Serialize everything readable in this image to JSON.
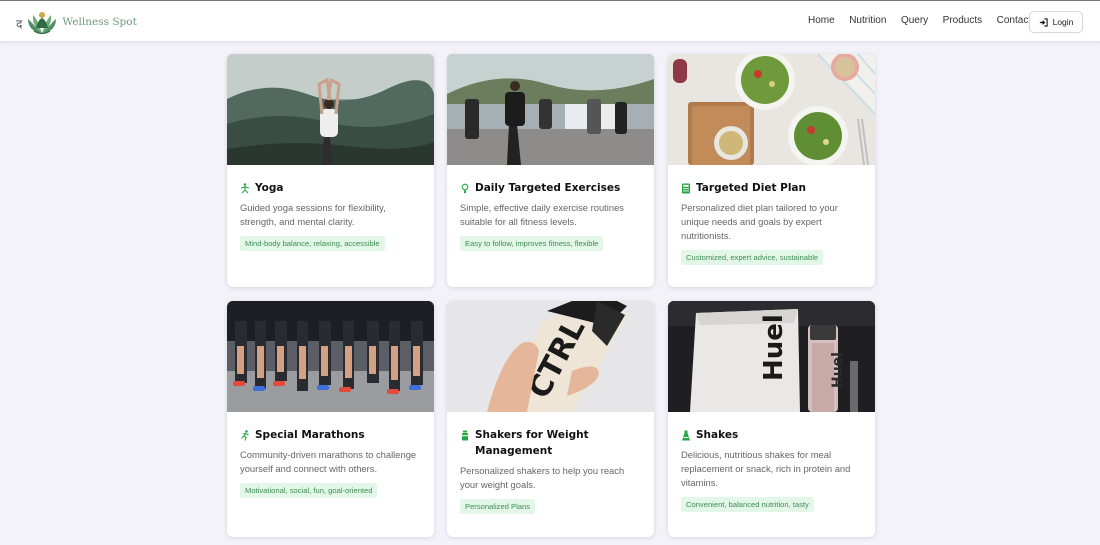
{
  "brand": {
    "glyph": "द",
    "name": "Wellness Spot"
  },
  "nav": {
    "links": [
      "Home",
      "Nutrition",
      "Query",
      "Products",
      "Contact"
    ],
    "login": "Login"
  },
  "colors": {
    "accent": "#26a744",
    "tag_bg": "#e3f7e8",
    "tag_text": "#3f8c55",
    "brand_text": "#6e9b7c"
  },
  "cards": [
    {
      "icon": "yoga-person-icon",
      "title": "Yoga",
      "description": "Guided yoga sessions for flexibility, strength, and mental clarity.",
      "tag": "Mind-body balance, relaxing, accessible",
      "image": "yoga-photo"
    },
    {
      "icon": "lightbulb-icon",
      "title": "Daily Targeted Exercises",
      "description": "Simple, effective daily exercise routines suitable for all fitness levels.",
      "tag": "Easy to follow, improves fitness, flexible",
      "image": "group-running-photo"
    },
    {
      "icon": "calculator-icon",
      "title": "Targeted Diet Plan",
      "description": "Personalized diet plan tailored to your unique needs and goals by expert nutritionists.",
      "tag": "Customized, expert advice, sustainable",
      "image": "salad-table-photo"
    },
    {
      "icon": "running-icon",
      "title": "Special Marathons",
      "description": "Community-driven marathons to challenge yourself and connect with others.",
      "tag": "Motivational, social, fun, goal-oriented",
      "image": "marathon-photo"
    },
    {
      "icon": "shaker-bottle-icon",
      "title": "Shakers for Weight Management",
      "description": "Personalized shakers to help you reach your weight goals.",
      "tag": "Personalized Plans",
      "image": "ctrl-shaker-photo"
    },
    {
      "icon": "flask-icon",
      "title": "Shakes",
      "description": "Delicious, nutritious shakes for meal replacement or snack, rich in protein and vitamins.",
      "tag": "Convenient, balanced nutrition, tasty",
      "image": "huel-shake-photo"
    }
  ]
}
